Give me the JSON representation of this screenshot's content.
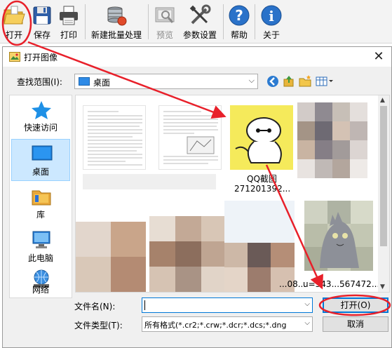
{
  "toolbar": {
    "items": [
      {
        "label": "打开",
        "icon": "folder-open-icon"
      },
      {
        "label": "保存",
        "icon": "floppy-disk-icon"
      },
      {
        "label": "打印",
        "icon": "printer-icon"
      },
      {
        "label": "新建批量处理",
        "icon": "batch-database-icon"
      },
      {
        "label": "预览",
        "icon": "preview-icon",
        "disabled": true
      },
      {
        "label": "参数设置",
        "icon": "tools-icon"
      },
      {
        "label": "帮助",
        "icon": "help-icon"
      },
      {
        "label": "关于",
        "icon": "info-icon"
      }
    ]
  },
  "dialog": {
    "title": "打开图像",
    "close_glyph": "✕",
    "look_in_label": "查找范围(I):",
    "look_in_value": "桌面",
    "places": [
      {
        "label": "快速访问",
        "icon": "star-icon"
      },
      {
        "label": "桌面",
        "icon": "desktop-icon",
        "selected": true
      },
      {
        "label": "库",
        "icon": "library-icon"
      },
      {
        "label": "此电脑",
        "icon": "computer-icon"
      },
      {
        "label": "网络",
        "icon": "network-icon"
      }
    ],
    "files": [
      {
        "caption": "QQ截图",
        "caption2": "271201392..."
      },
      {
        "caption": "...08..."
      },
      {
        "caption": "u=343...567472..."
      }
    ],
    "file_name_label": "文件名(N):",
    "file_name_value": "",
    "file_type_label": "文件类型(T):",
    "file_type_value": "所有格式(*.cr2;*.crw;*.dcr;*.dcs;*.dng",
    "open_button": "打开(O)",
    "cancel_button": "取消"
  },
  "colors": {
    "accent": "#0078d7",
    "annotation": "#e8202a",
    "selection": "#cce8ff"
  }
}
